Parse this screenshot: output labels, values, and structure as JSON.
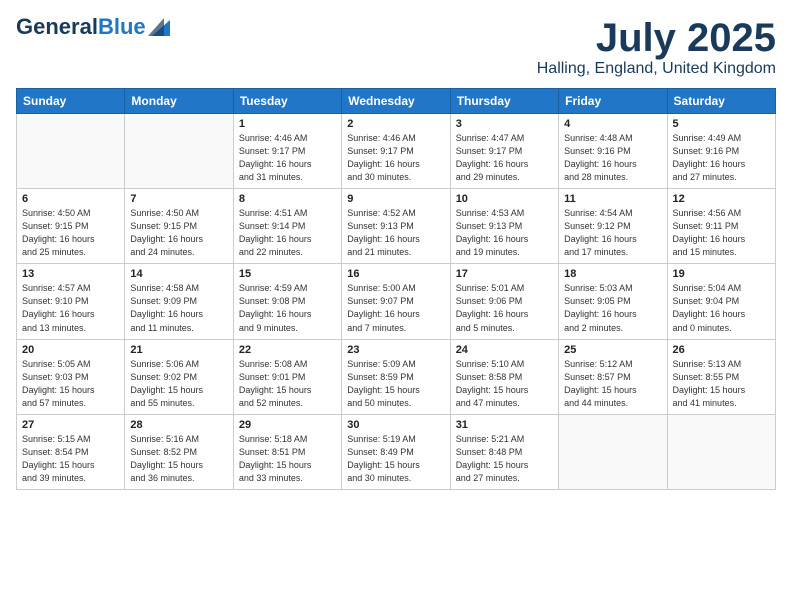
{
  "logo": {
    "line1": "General",
    "line2": "Blue"
  },
  "header": {
    "month": "July 2025",
    "location": "Halling, England, United Kingdom"
  },
  "weekdays": [
    "Sunday",
    "Monday",
    "Tuesday",
    "Wednesday",
    "Thursday",
    "Friday",
    "Saturday"
  ],
  "weeks": [
    [
      {
        "day": "",
        "detail": ""
      },
      {
        "day": "",
        "detail": ""
      },
      {
        "day": "1",
        "detail": "Sunrise: 4:46 AM\nSunset: 9:17 PM\nDaylight: 16 hours\nand 31 minutes."
      },
      {
        "day": "2",
        "detail": "Sunrise: 4:46 AM\nSunset: 9:17 PM\nDaylight: 16 hours\nand 30 minutes."
      },
      {
        "day": "3",
        "detail": "Sunrise: 4:47 AM\nSunset: 9:17 PM\nDaylight: 16 hours\nand 29 minutes."
      },
      {
        "day": "4",
        "detail": "Sunrise: 4:48 AM\nSunset: 9:16 PM\nDaylight: 16 hours\nand 28 minutes."
      },
      {
        "day": "5",
        "detail": "Sunrise: 4:49 AM\nSunset: 9:16 PM\nDaylight: 16 hours\nand 27 minutes."
      }
    ],
    [
      {
        "day": "6",
        "detail": "Sunrise: 4:50 AM\nSunset: 9:15 PM\nDaylight: 16 hours\nand 25 minutes."
      },
      {
        "day": "7",
        "detail": "Sunrise: 4:50 AM\nSunset: 9:15 PM\nDaylight: 16 hours\nand 24 minutes."
      },
      {
        "day": "8",
        "detail": "Sunrise: 4:51 AM\nSunset: 9:14 PM\nDaylight: 16 hours\nand 22 minutes."
      },
      {
        "day": "9",
        "detail": "Sunrise: 4:52 AM\nSunset: 9:13 PM\nDaylight: 16 hours\nand 21 minutes."
      },
      {
        "day": "10",
        "detail": "Sunrise: 4:53 AM\nSunset: 9:13 PM\nDaylight: 16 hours\nand 19 minutes."
      },
      {
        "day": "11",
        "detail": "Sunrise: 4:54 AM\nSunset: 9:12 PM\nDaylight: 16 hours\nand 17 minutes."
      },
      {
        "day": "12",
        "detail": "Sunrise: 4:56 AM\nSunset: 9:11 PM\nDaylight: 16 hours\nand 15 minutes."
      }
    ],
    [
      {
        "day": "13",
        "detail": "Sunrise: 4:57 AM\nSunset: 9:10 PM\nDaylight: 16 hours\nand 13 minutes."
      },
      {
        "day": "14",
        "detail": "Sunrise: 4:58 AM\nSunset: 9:09 PM\nDaylight: 16 hours\nand 11 minutes."
      },
      {
        "day": "15",
        "detail": "Sunrise: 4:59 AM\nSunset: 9:08 PM\nDaylight: 16 hours\nand 9 minutes."
      },
      {
        "day": "16",
        "detail": "Sunrise: 5:00 AM\nSunset: 9:07 PM\nDaylight: 16 hours\nand 7 minutes."
      },
      {
        "day": "17",
        "detail": "Sunrise: 5:01 AM\nSunset: 9:06 PM\nDaylight: 16 hours\nand 5 minutes."
      },
      {
        "day": "18",
        "detail": "Sunrise: 5:03 AM\nSunset: 9:05 PM\nDaylight: 16 hours\nand 2 minutes."
      },
      {
        "day": "19",
        "detail": "Sunrise: 5:04 AM\nSunset: 9:04 PM\nDaylight: 16 hours\nand 0 minutes."
      }
    ],
    [
      {
        "day": "20",
        "detail": "Sunrise: 5:05 AM\nSunset: 9:03 PM\nDaylight: 15 hours\nand 57 minutes."
      },
      {
        "day": "21",
        "detail": "Sunrise: 5:06 AM\nSunset: 9:02 PM\nDaylight: 15 hours\nand 55 minutes."
      },
      {
        "day": "22",
        "detail": "Sunrise: 5:08 AM\nSunset: 9:01 PM\nDaylight: 15 hours\nand 52 minutes."
      },
      {
        "day": "23",
        "detail": "Sunrise: 5:09 AM\nSunset: 8:59 PM\nDaylight: 15 hours\nand 50 minutes."
      },
      {
        "day": "24",
        "detail": "Sunrise: 5:10 AM\nSunset: 8:58 PM\nDaylight: 15 hours\nand 47 minutes."
      },
      {
        "day": "25",
        "detail": "Sunrise: 5:12 AM\nSunset: 8:57 PM\nDaylight: 15 hours\nand 44 minutes."
      },
      {
        "day": "26",
        "detail": "Sunrise: 5:13 AM\nSunset: 8:55 PM\nDaylight: 15 hours\nand 41 minutes."
      }
    ],
    [
      {
        "day": "27",
        "detail": "Sunrise: 5:15 AM\nSunset: 8:54 PM\nDaylight: 15 hours\nand 39 minutes."
      },
      {
        "day": "28",
        "detail": "Sunrise: 5:16 AM\nSunset: 8:52 PM\nDaylight: 15 hours\nand 36 minutes."
      },
      {
        "day": "29",
        "detail": "Sunrise: 5:18 AM\nSunset: 8:51 PM\nDaylight: 15 hours\nand 33 minutes."
      },
      {
        "day": "30",
        "detail": "Sunrise: 5:19 AM\nSunset: 8:49 PM\nDaylight: 15 hours\nand 30 minutes."
      },
      {
        "day": "31",
        "detail": "Sunrise: 5:21 AM\nSunset: 8:48 PM\nDaylight: 15 hours\nand 27 minutes."
      },
      {
        "day": "",
        "detail": ""
      },
      {
        "day": "",
        "detail": ""
      }
    ]
  ]
}
